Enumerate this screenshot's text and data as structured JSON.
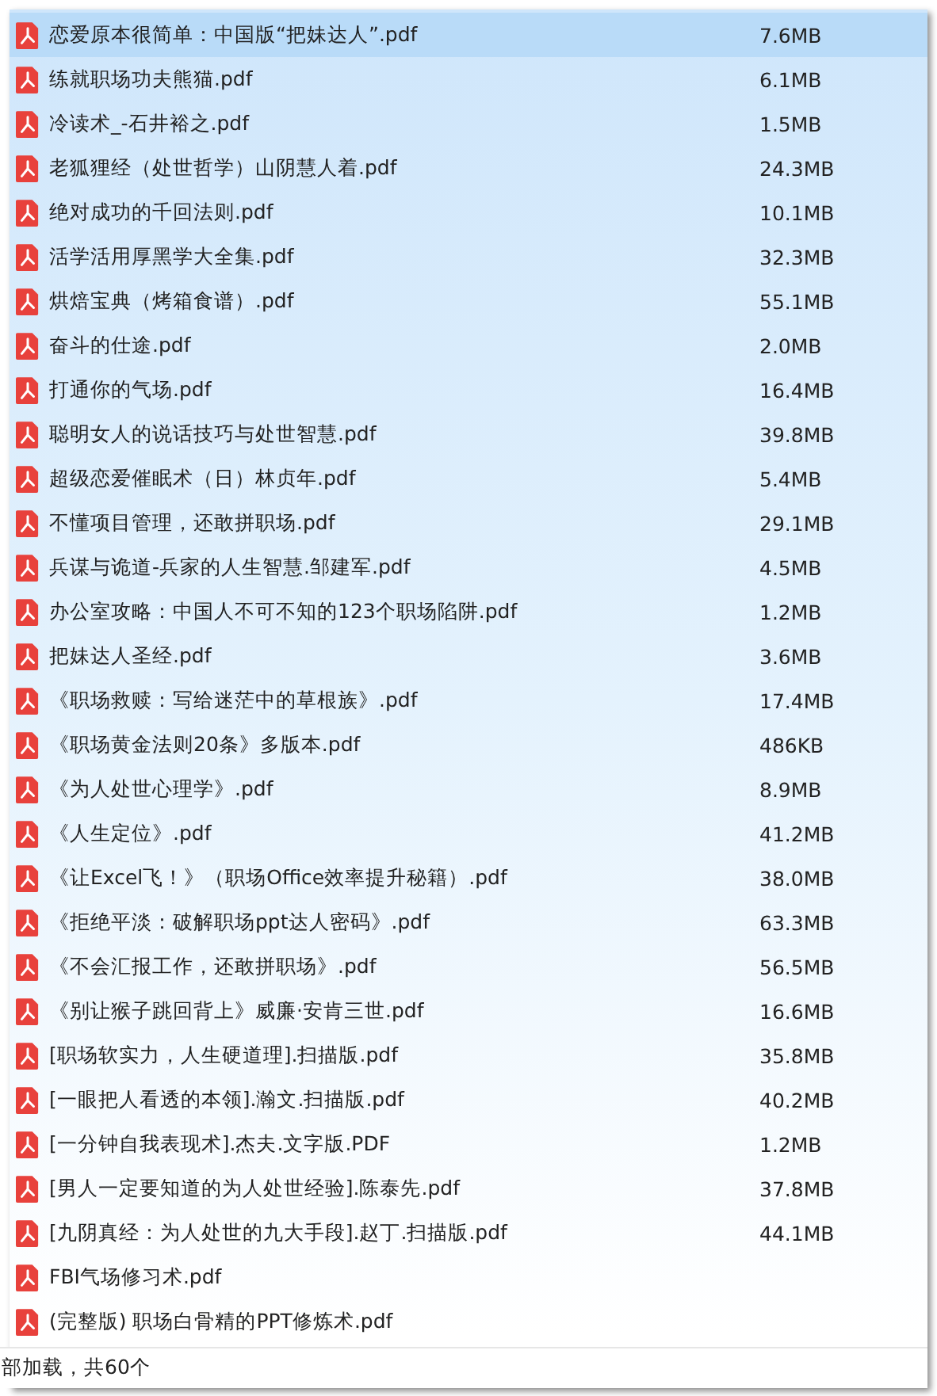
{
  "files": [
    {
      "name": "恋爱原本很简单：中国版“把妹达人”.pdf",
      "size": "7.6MB",
      "selected": true
    },
    {
      "name": "练就职场功夫熊猫.pdf",
      "size": "6.1MB",
      "selected": false
    },
    {
      "name": "冷读术_-石井裕之.pdf",
      "size": "1.5MB",
      "selected": false
    },
    {
      "name": "老狐狸经（处世哲学）山阴慧人着.pdf",
      "size": "24.3MB",
      "selected": false
    },
    {
      "name": "绝对成功的千回法则.pdf",
      "size": "10.1MB",
      "selected": false
    },
    {
      "name": "活学活用厚黑学大全集.pdf",
      "size": "32.3MB",
      "selected": false
    },
    {
      "name": "烘焙宝典（烤箱食谱）.pdf",
      "size": "55.1MB",
      "selected": false
    },
    {
      "name": "奋斗的仕途.pdf",
      "size": "2.0MB",
      "selected": false
    },
    {
      "name": "打通你的气场.pdf",
      "size": "16.4MB",
      "selected": false
    },
    {
      "name": "聪明女人的说话技巧与处世智慧.pdf",
      "size": "39.8MB",
      "selected": false
    },
    {
      "name": "超级恋爱催眠术（日）林贞年.pdf",
      "size": "5.4MB",
      "selected": false
    },
    {
      "name": "不懂项目管理，还敢拼职场.pdf",
      "size": "29.1MB",
      "selected": false
    },
    {
      "name": "兵谋与诡道-兵家的人生智慧.邹建军.pdf",
      "size": "4.5MB",
      "selected": false
    },
    {
      "name": "办公室攻略：中国人不可不知的123个职场陷阱.pdf",
      "size": "1.2MB",
      "selected": false
    },
    {
      "name": "把妹达人圣经.pdf",
      "size": "3.6MB",
      "selected": false
    },
    {
      "name": "《职场救赎：写给迷茫中的草根族》.pdf",
      "size": "17.4MB",
      "selected": false
    },
    {
      "name": "《职场黄金法则20条》多版本.pdf",
      "size": "486KB",
      "selected": false
    },
    {
      "name": "《为人处世心理学》.pdf",
      "size": "8.9MB",
      "selected": false
    },
    {
      "name": "《人生定位》.pdf",
      "size": "41.2MB",
      "selected": false
    },
    {
      "name": "《让Excel飞！》（职场Office效率提升秘籍）.pdf",
      "size": "38.0MB",
      "selected": false
    },
    {
      "name": "《拒绝平淡：破解职场ppt达人密码》.pdf",
      "size": "63.3MB",
      "selected": false
    },
    {
      "name": "《不会汇报工作，还敢拼职场》.pdf",
      "size": "56.5MB",
      "selected": false
    },
    {
      "name": "《别让猴子跳回背上》威廉·安肯三世.pdf",
      "size": "16.6MB",
      "selected": false
    },
    {
      "name": "[职场软实力，人生硬道理].扫描版.pdf",
      "size": "35.8MB",
      "selected": false
    },
    {
      "name": "[一眼把人看透的本领].瀚文.扫描版.pdf",
      "size": "40.2MB",
      "selected": false
    },
    {
      "name": "[一分钟自我表现术].杰夫.文字版.PDF",
      "size": "1.2MB",
      "selected": false
    },
    {
      "name": "[男人一定要知道的为人处世经验].陈泰先.pdf",
      "size": "37.8MB",
      "selected": false
    },
    {
      "name": "[九阴真经：为人处世的九大手段].赵丁.扫描版.pdf",
      "size": "44.1MB",
      "selected": false
    },
    {
      "name": "FBI气场修习术.pdf",
      "selected": false
    },
    {
      "name": "(完整版) 职场白骨精的PPT修炼术.pdf",
      "selected": false
    }
  ],
  "status_bar": "部加载，共60个"
}
